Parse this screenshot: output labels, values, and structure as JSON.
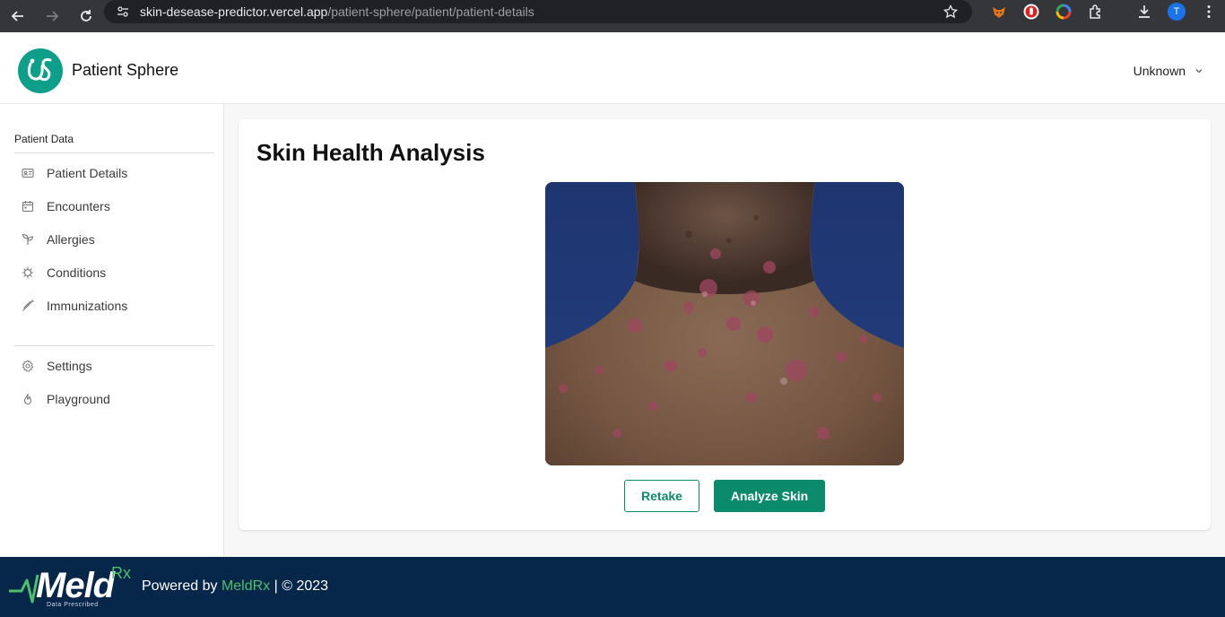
{
  "browser": {
    "url_domain": "skin-desease-predictor.vercel.app",
    "url_path": "/patient-sphere/patient/patient-details",
    "profile_initial": "T"
  },
  "header": {
    "app_title": "Patient Sphere",
    "user_name": "Unknown"
  },
  "sidebar": {
    "heading": "Patient Data",
    "items": [
      {
        "label": "Patient Details",
        "icon": "id-card-icon"
      },
      {
        "label": "Encounters",
        "icon": "calendar-icon"
      },
      {
        "label": "Allergies",
        "icon": "plant-icon"
      },
      {
        "label": "Conditions",
        "icon": "virus-icon"
      },
      {
        "label": "Immunizations",
        "icon": "syringe-icon"
      }
    ],
    "secondary_items": [
      {
        "label": "Settings",
        "icon": "gear-icon"
      },
      {
        "label": "Playground",
        "icon": "flame-icon"
      }
    ]
  },
  "main": {
    "title": "Skin Health Analysis",
    "retake_label": "Retake",
    "analyze_label": "Analyze Skin"
  },
  "footer": {
    "logo_word": "Meld",
    "logo_rx": "Rx",
    "logo_tagline": "Data Prescribed",
    "powered_by": "Powered by ",
    "link_text": "MeldRx",
    "copyright": " | © 2023"
  },
  "colors": {
    "brand_green": "#0b8a6c",
    "footer_bg": "#06264a",
    "link_green": "#4fc06a",
    "logo_teal": "#0e9f8a"
  }
}
